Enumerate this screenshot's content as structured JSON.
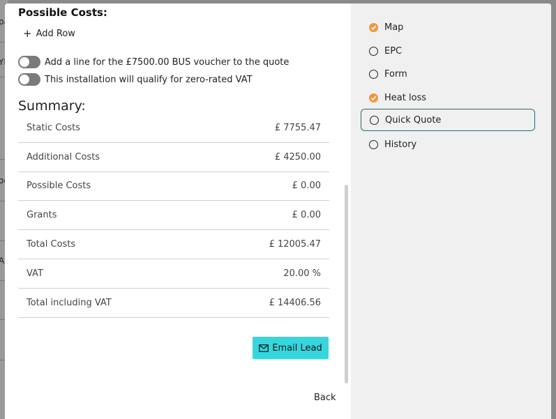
{
  "background": {
    "fragments": [
      "pa",
      "YE",
      "oo",
      "AI"
    ]
  },
  "possible_costs": {
    "title": "Possible Costs:",
    "add_row_label": "Add Row"
  },
  "toggles": [
    {
      "label": "Add a line for the £7500.00 BUS voucher to the quote",
      "checked": false
    },
    {
      "label": "This installation will qualify for zero-rated VAT",
      "checked": false
    }
  ],
  "summary": {
    "title": "Summary:",
    "rows": [
      {
        "label": "Static Costs",
        "value": "£ 7755.47"
      },
      {
        "label": "Additional Costs",
        "value": "£ 4250.00"
      },
      {
        "label": "Possible Costs",
        "value": "£ 0.00"
      },
      {
        "label": "Grants",
        "value": "£ 0.00"
      },
      {
        "label": "Total Costs",
        "value": "£ 12005.47"
      },
      {
        "label": "VAT",
        "value": "20.00 %"
      },
      {
        "label": "Total including VAT",
        "value": "£ 14406.56"
      }
    ]
  },
  "actions": {
    "email_lead": "Email Lead",
    "back": "Back"
  },
  "steps": [
    {
      "label": "Map",
      "status": "complete",
      "icon": "check-circle-icon"
    },
    {
      "label": "EPC",
      "status": "pending",
      "icon": "radio-icon"
    },
    {
      "label": "Form",
      "status": "pending",
      "icon": "radio-icon"
    },
    {
      "label": "Heat loss",
      "status": "complete",
      "icon": "check-circle-icon"
    },
    {
      "label": "Quick Quote",
      "status": "active",
      "icon": "radio-icon"
    },
    {
      "label": "History",
      "status": "pending",
      "icon": "radio-icon"
    }
  ],
  "colors": {
    "accent_button": "#36d6dd",
    "complete_step": "#f4973a",
    "active_border": "#2a6a6a"
  }
}
